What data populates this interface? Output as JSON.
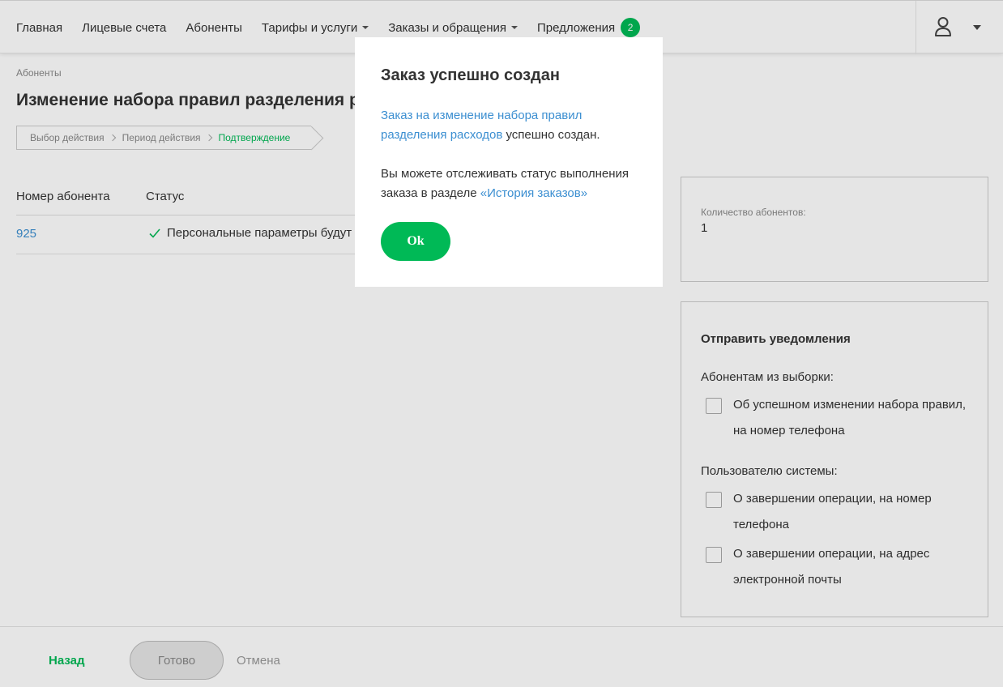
{
  "nav": {
    "items": [
      {
        "label": "Главная"
      },
      {
        "label": "Лицевые счета"
      },
      {
        "label": "Абоненты"
      },
      {
        "label": "Тарифы и услуги"
      },
      {
        "label": "Заказы и обращения"
      },
      {
        "label": "Предложения",
        "badge": "2"
      }
    ],
    "user_icon": "user-icon"
  },
  "breadcrumb": "Абоненты",
  "page_title": "Изменение набора правил разделения р",
  "steps": [
    {
      "label": "Выбор действия"
    },
    {
      "label": "Период действия"
    },
    {
      "label": "Подтверждение",
      "active": true
    }
  ],
  "table": {
    "columns": [
      "Номер абонента",
      "Статус"
    ],
    "rows": [
      {
        "number": "925",
        "status": "Персональные параметры будут"
      }
    ]
  },
  "summary": {
    "count_label": "Количество абонентов:",
    "count_value": "1"
  },
  "notifications": {
    "title": "Отправить уведомления",
    "subscribers_label": "Абонентам из выборки:",
    "opt1": "Об успешном изменении набора правил, на номер телефона",
    "users_label": "Пользователю системы:",
    "opt2": "О завершении операции, на номер телефона",
    "opt3": "О завершении операции, на адрес электронной почты"
  },
  "footer": {
    "back": "Назад",
    "done": "Готово",
    "cancel": "Отмена"
  },
  "modal": {
    "title": "Заказ успешно создан",
    "p1_link": "Заказ на изменение набора правил разделения расходов",
    "p1_text": " успешно создан.",
    "p2_text": "Вы можете отслеживать статус выполнения заказа в разделе ",
    "p2_link": "«История заказов»",
    "ok": "Ok"
  },
  "colors": {
    "accent": "#00b956",
    "link": "#3c8fd1"
  }
}
